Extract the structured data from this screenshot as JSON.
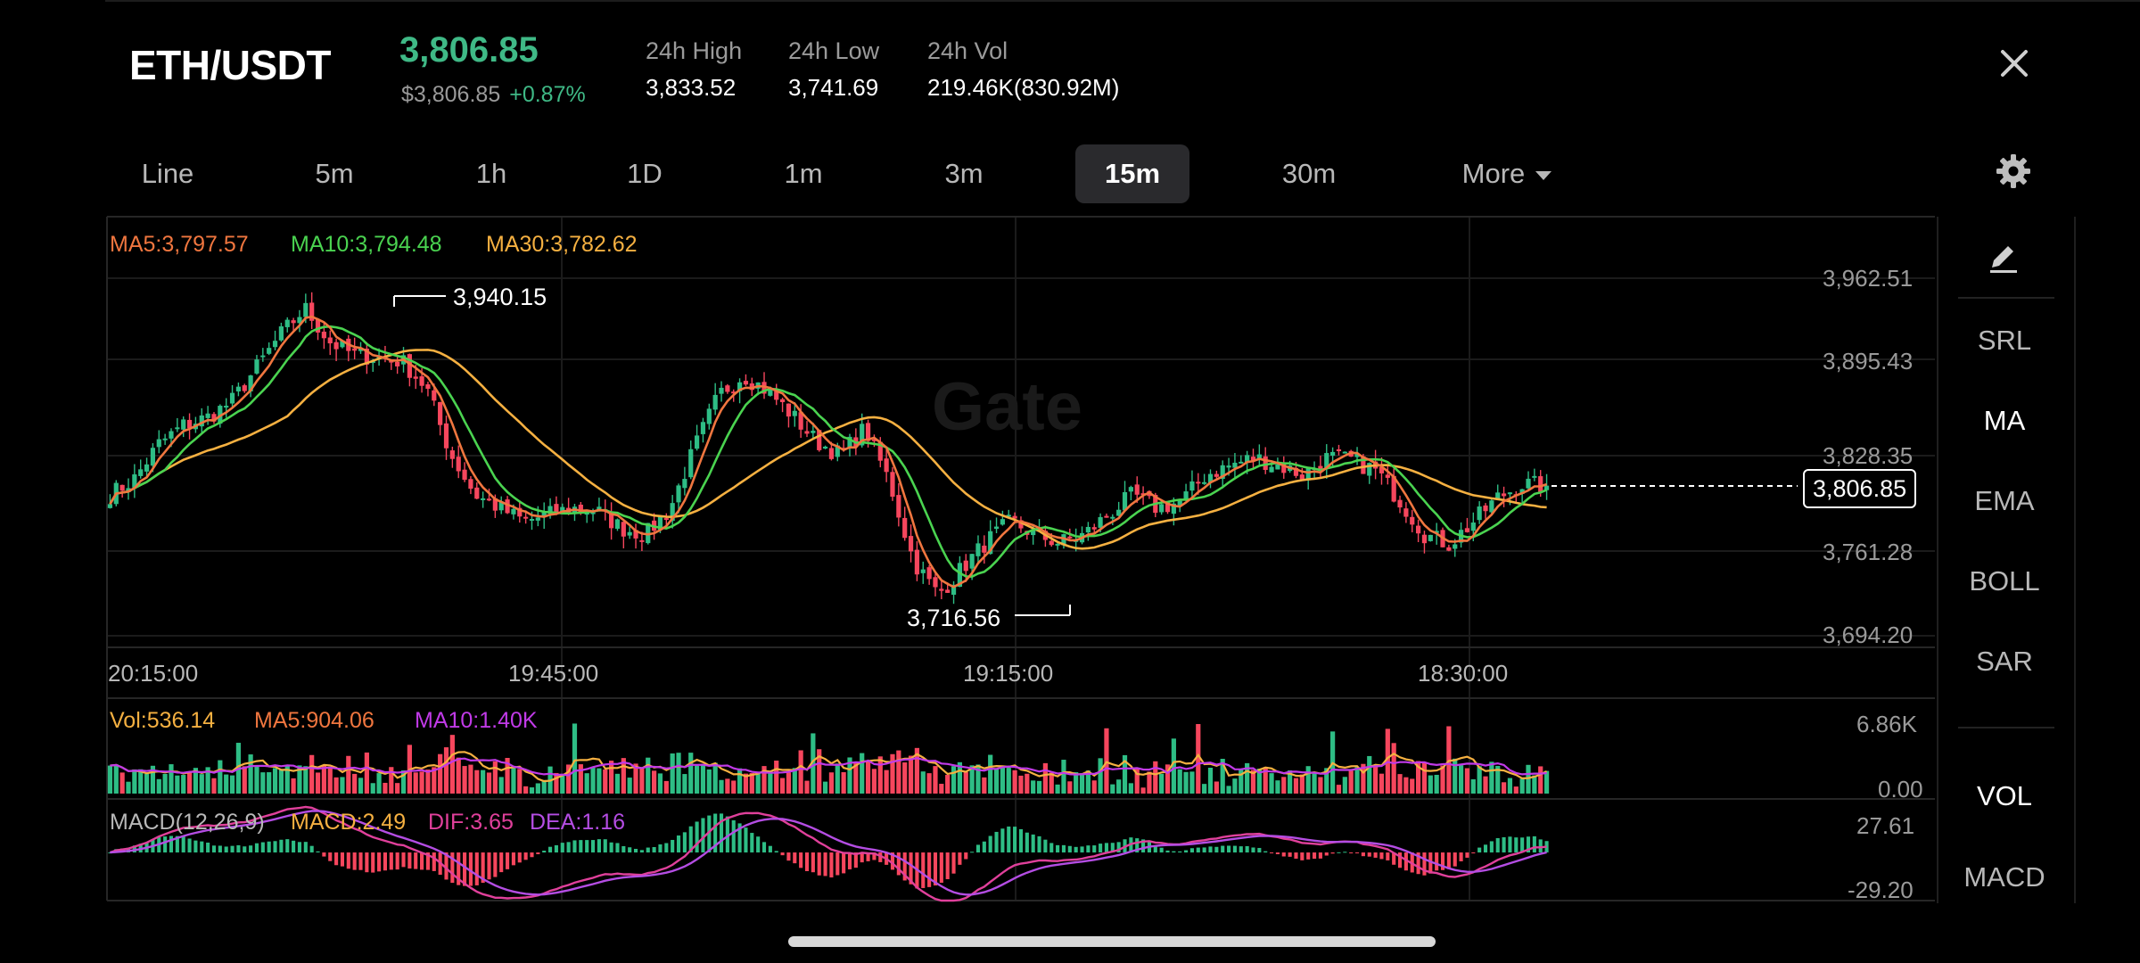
{
  "header": {
    "pair": "ETH/USDT",
    "last_price": "3,806.85",
    "fiat_price": "$3,806.85",
    "change": "+0.87%",
    "stats": [
      {
        "label": "24h High",
        "value": "3,833.52"
      },
      {
        "label": "24h Low",
        "value": "3,741.69"
      },
      {
        "label": "24h Vol",
        "value": "219.46K(830.92M)"
      }
    ]
  },
  "timeframes": [
    {
      "label": "Line",
      "active": false
    },
    {
      "label": "5m",
      "active": false
    },
    {
      "label": "1h",
      "active": false
    },
    {
      "label": "1D",
      "active": false
    },
    {
      "label": "1m",
      "active": false
    },
    {
      "label": "3m",
      "active": false
    },
    {
      "label": "15m",
      "active": true
    },
    {
      "label": "30m",
      "active": false
    },
    {
      "label": "More",
      "active": false
    }
  ],
  "icons": {
    "close": "close-icon",
    "settings": "gear-icon",
    "draw": "pencil-icon",
    "more_caret": "caret-down-icon"
  },
  "colors": {
    "up": "#2ebd85",
    "down": "#f6465d",
    "ma5": "#f0763f",
    "ma10": "#4ad350",
    "ma30": "#f5b041",
    "vol_ma10": "#c13ae8",
    "dif": "#e0409b",
    "dea": "#b44de3"
  },
  "ma_legend": {
    "ma5": "MA5:3,797.57",
    "ma10": "MA10:3,794.48",
    "ma30": "MA30:3,782.62"
  },
  "price_axis": [
    "3,962.51",
    "3,895.43",
    "3,828.35",
    "3,761.28",
    "3,694.20"
  ],
  "time_axis": [
    "20:15:00",
    "19:45:00",
    "19:15:00",
    "18:30:00"
  ],
  "annotations": {
    "high": "3,940.15",
    "low": "3,716.56",
    "last": "3,806.85"
  },
  "volume": {
    "legend": {
      "vol": "Vol:536.14",
      "ma5": "MA5:904.06",
      "ma10": "MA10:1.40K"
    },
    "axis": [
      "6.86K",
      "0.00"
    ]
  },
  "macd": {
    "legend": {
      "params": "MACD(12,26,9)",
      "macd": "MACD:2.49",
      "dif": "DIF:3.65",
      "dea": "DEA:1.16"
    },
    "axis": [
      "27.61",
      "-29.20"
    ]
  },
  "sidebar": {
    "items": [
      "SRL",
      "MA",
      "EMA",
      "BOLL",
      "SAR",
      "VOL",
      "MACD"
    ],
    "active": [
      "MA",
      "VOL"
    ]
  },
  "watermark": "Gate",
  "chart_data": {
    "type": "line",
    "title": "ETH/USDT 15m",
    "xlabel": "",
    "ylabel": "",
    "x_ticks": [
      "20:15:00",
      "19:45:00",
      "19:15:00",
      "18:30:00"
    ],
    "ylim": [
      3694.2,
      3962.51
    ],
    "price_anchors": [
      3800,
      3812,
      3838,
      3852,
      3858,
      3870,
      3895,
      3920,
      3940,
      3915,
      3905,
      3903,
      3900,
      3880,
      3830,
      3800,
      3790,
      3780,
      3785,
      3790,
      3788,
      3775,
      3770,
      3790,
      3835,
      3875,
      3890,
      3878,
      3860,
      3840,
      3830,
      3850,
      3810,
      3750,
      3725,
      3745,
      3765,
      3780,
      3770,
      3764,
      3770,
      3785,
      3800,
      3790,
      3795,
      3815,
      3822,
      3828,
      3822,
      3815,
      3828,
      3826,
      3818,
      3795,
      3770,
      3763,
      3780,
      3798,
      3808,
      3806.85
    ],
    "series": [
      {
        "name": "MA5",
        "values_last": 3797.57
      },
      {
        "name": "MA10",
        "values_last": 3794.48
      },
      {
        "name": "MA30",
        "values_last": 3782.62
      }
    ],
    "volume_max": 6860,
    "macd_range": [
      -29.2,
      27.61
    ]
  }
}
